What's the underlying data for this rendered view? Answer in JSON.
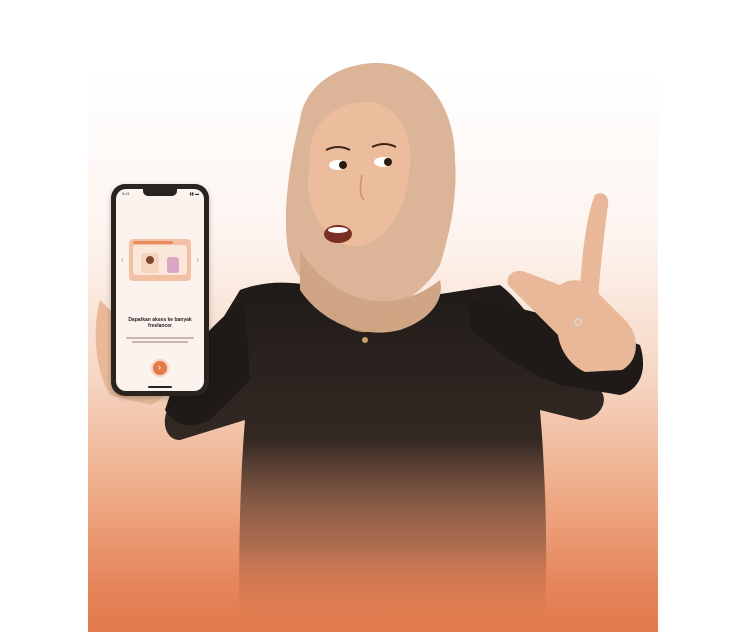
{
  "image": {
    "alt": "Woman in a beige hijab and black top holding out a smartphone showing an app onboarding screen and pointing at it, on a white-to-orange gradient background",
    "colors": {
      "background": "#ffffff",
      "gradient_top": "#ffffff",
      "gradient_bottom": "#e27a4c",
      "hijab": "#ddb79a",
      "shirt": "#1f1a18",
      "skin": "#e8b898",
      "phone_accent": "#e27a4c"
    }
  },
  "phone": {
    "status_time": "9:41",
    "status_icons": "▮▮ ▬",
    "chevron_left": "‹",
    "chevron_right": "›",
    "heading": "Dapatkan akses ke banyak freelancer"
  }
}
